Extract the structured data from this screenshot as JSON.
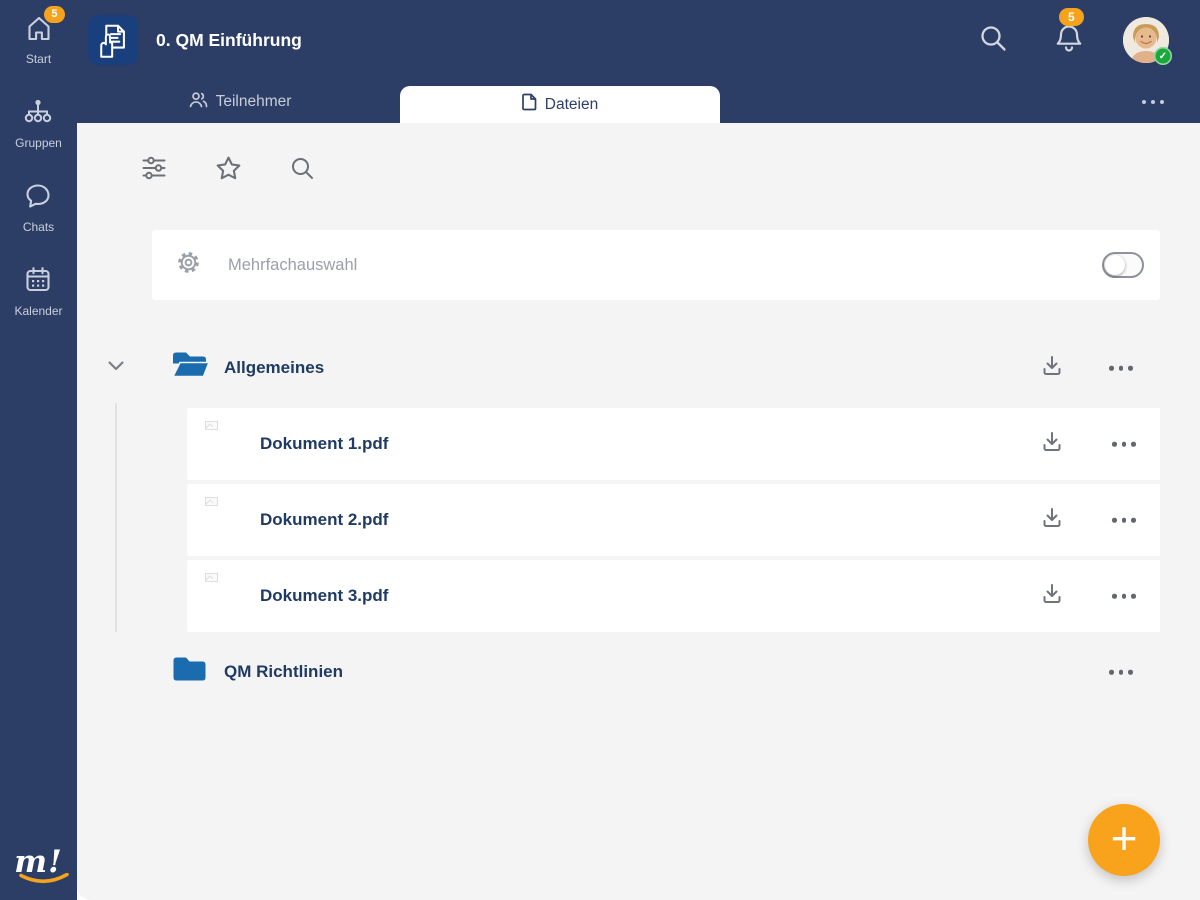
{
  "colors": {
    "navy": "#2d3e66",
    "accent_orange": "#f5a31c",
    "folder_blue": "#1a6cae",
    "content_bg": "#f4f4f5",
    "text_navy": "#1f3a63",
    "fab_orange": "#f9a21b"
  },
  "sidebar": {
    "items": [
      {
        "label": "Start",
        "badge": "5",
        "icon": "home-icon"
      },
      {
        "label": "Gruppen",
        "icon": "org-chart-icon"
      },
      {
        "label": "Chats",
        "icon": "chat-bubble-icon"
      },
      {
        "label": "Kalender",
        "icon": "calendar-icon"
      }
    ],
    "logo_text": "m!"
  },
  "header": {
    "title": "0. QM Einführung",
    "bell_badge": "5"
  },
  "tabs": {
    "teilnehmer": "Teilnehmer",
    "dateien": "Dateien"
  },
  "multiselect": {
    "label": "Mehrfachauswahl",
    "state": "off"
  },
  "file_tree": {
    "folders": [
      {
        "name": "Allgemeines",
        "expanded": true,
        "documents": [
          {
            "name": "Dokument 1.pdf"
          },
          {
            "name": "Dokument 2.pdf"
          },
          {
            "name": "Dokument 3.pdf"
          }
        ]
      },
      {
        "name": "QM Richtlinien",
        "expanded": false,
        "documents": []
      }
    ]
  },
  "fab": {
    "label": "+"
  }
}
